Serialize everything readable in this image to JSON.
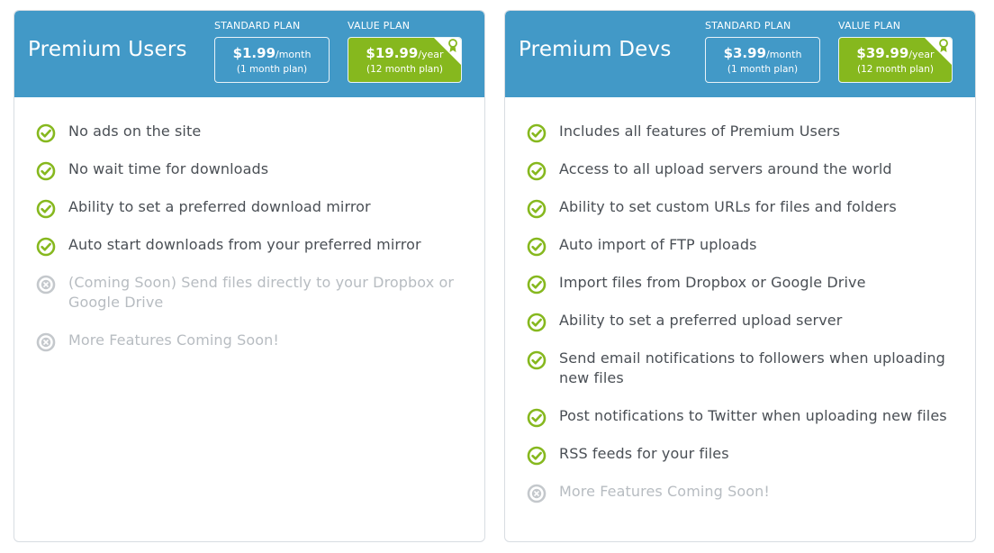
{
  "users": {
    "title": "Premium Users",
    "standard": {
      "label": "STANDARD PLAN",
      "price": "$1.99",
      "period": "/month",
      "term": "(1 month plan)"
    },
    "value": {
      "label": "VALUE PLAN",
      "price": "$19.99",
      "period": "/year",
      "term": "(12 month plan)"
    },
    "features": [
      {
        "text": "No ads on the site",
        "available": true
      },
      {
        "text": "No wait time for downloads",
        "available": true
      },
      {
        "text": "Ability to set a preferred download mirror",
        "available": true
      },
      {
        "text": "Auto start downloads from your preferred mirror",
        "available": true
      },
      {
        "text": "(Coming Soon) Send files directly to your Dropbox or Google Drive",
        "available": false
      },
      {
        "text": "More Features Coming Soon!",
        "available": false
      }
    ]
  },
  "devs": {
    "title": "Premium Devs",
    "standard": {
      "label": "STANDARD PLAN",
      "price": "$3.99",
      "period": "/month",
      "term": "(1 month plan)"
    },
    "value": {
      "label": "VALUE PLAN",
      "price": "$39.99",
      "period": "/year",
      "term": "(12 month plan)"
    },
    "features": [
      {
        "text": "Includes all features of Premium Users",
        "available": true
      },
      {
        "text": "Access to all upload servers around the world",
        "available": true
      },
      {
        "text": "Ability to set custom URLs for files and folders",
        "available": true
      },
      {
        "text": "Auto import of FTP uploads",
        "available": true
      },
      {
        "text": "Import files from Dropbox or Google Drive",
        "available": true
      },
      {
        "text": "Ability to set a preferred upload server",
        "available": true
      },
      {
        "text": "Send email notifications to followers when uploading new files",
        "available": true
      },
      {
        "text": "Post notifications to Twitter when uploading new files",
        "available": true
      },
      {
        "text": "RSS feeds for your files",
        "available": true
      },
      {
        "text": "More Features Coming Soon!",
        "available": false
      }
    ]
  },
  "colors": {
    "header": "#4299c7",
    "value_plan": "#86b81e",
    "check": "#86b81e",
    "unavailable": "#c4c8cc"
  },
  "icons": {
    "available": "check-circle-icon",
    "unavailable": "x-circle-icon",
    "value_badge": "award-ribbon-icon"
  }
}
